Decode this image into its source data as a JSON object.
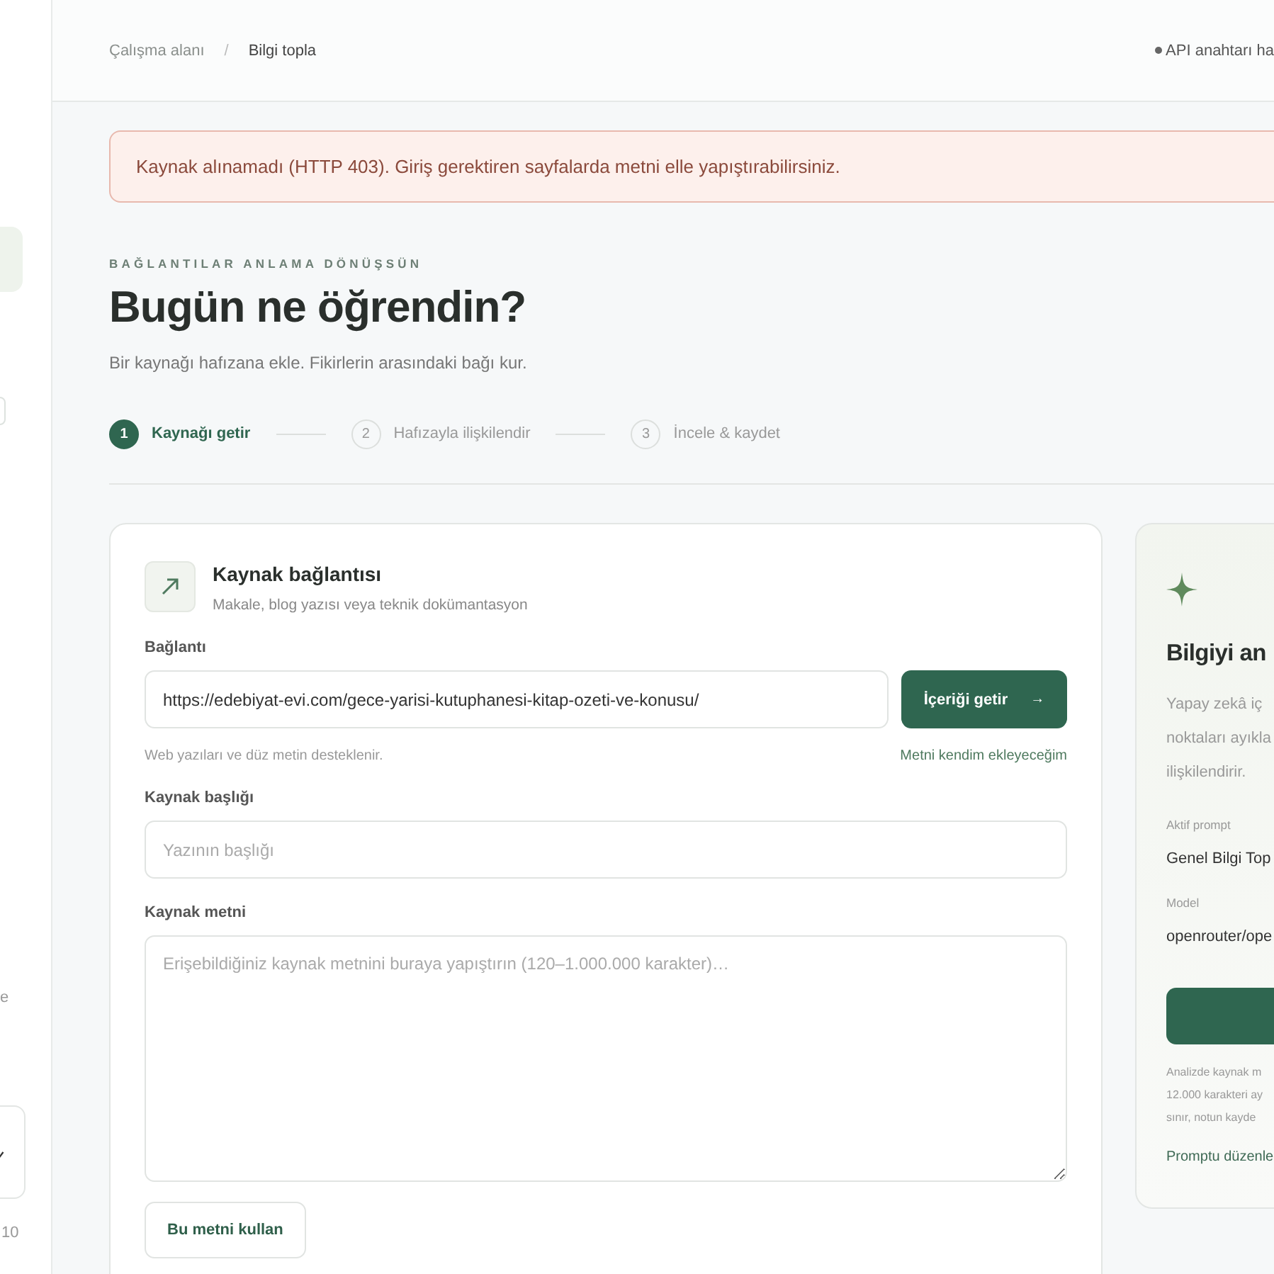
{
  "sidebar": {
    "items": [
      {
        "selected": true
      },
      {
        "selected": false
      }
    ],
    "fragment": "e",
    "version": "10"
  },
  "breadcrumb": [
    "Çalışma alanı",
    "Bilgi topla"
  ],
  "breadcrumb_separator": "/",
  "status": {
    "label": "API anahtarı ha"
  },
  "alert": "Kaynak alınamadı (HTTP 403). Giriş gerektiren sayfalarda metni elle yapıştırabilirsiniz.",
  "eyebrow": "BAĞLANTILAR ANLAMA DÖNÜŞSÜN",
  "title": "Bugün ne öğrendin?",
  "subtitle": "Bir kaynağı hafızana ekle. Fikirlerin arasındaki bağı kur.",
  "steps": [
    {
      "number": "1",
      "label": "Kaynağı getir",
      "selected": true
    },
    {
      "number": "2",
      "label": "Hafızayla ilişkilendir",
      "selected": false
    },
    {
      "number": "3",
      "label": "İncele & kaydet",
      "selected": false
    }
  ],
  "source_card": {
    "title": "Kaynak bağlantısı",
    "subtitle": "Makale, blog yazısı veya teknik dokümantasyon",
    "link_label": "Bağlantı",
    "link_value": "https://edebiyat-evi.com/gece-yarisi-kutuphanesi-kitap-ozeti-ve-konusu/",
    "fetch_button": "İçeriği getir",
    "fetch_arrow": "→",
    "hint": "Web yazıları ve düz metin desteklenir.",
    "manual_link": "Metni kendim ekleyeceğim",
    "title_label": "Kaynak başlığı",
    "title_placeholder": "Yazının başlığı",
    "text_label": "Kaynak metni",
    "text_placeholder": "Erişebildiğiniz kaynak metnini buraya yapıştırın (120–1.000.000 karakter)…",
    "use_button": "Bu metni kullan"
  },
  "analysis_panel": {
    "title": "Bilgiyi an",
    "description": [
      "Yapay zekâ iç",
      "noktaları ayıkla",
      "ilişkilendirir."
    ],
    "prompt_label": "Aktif prompt",
    "prompt_value": "Genel Bilgi Top",
    "model_label": "Model",
    "model_value": "openrouter/ope",
    "note": [
      "Analizde kaynak m",
      "12.000 karakteri ay",
      "sınır, notun kayde"
    ],
    "edit_link": "Promptu düzenle"
  }
}
